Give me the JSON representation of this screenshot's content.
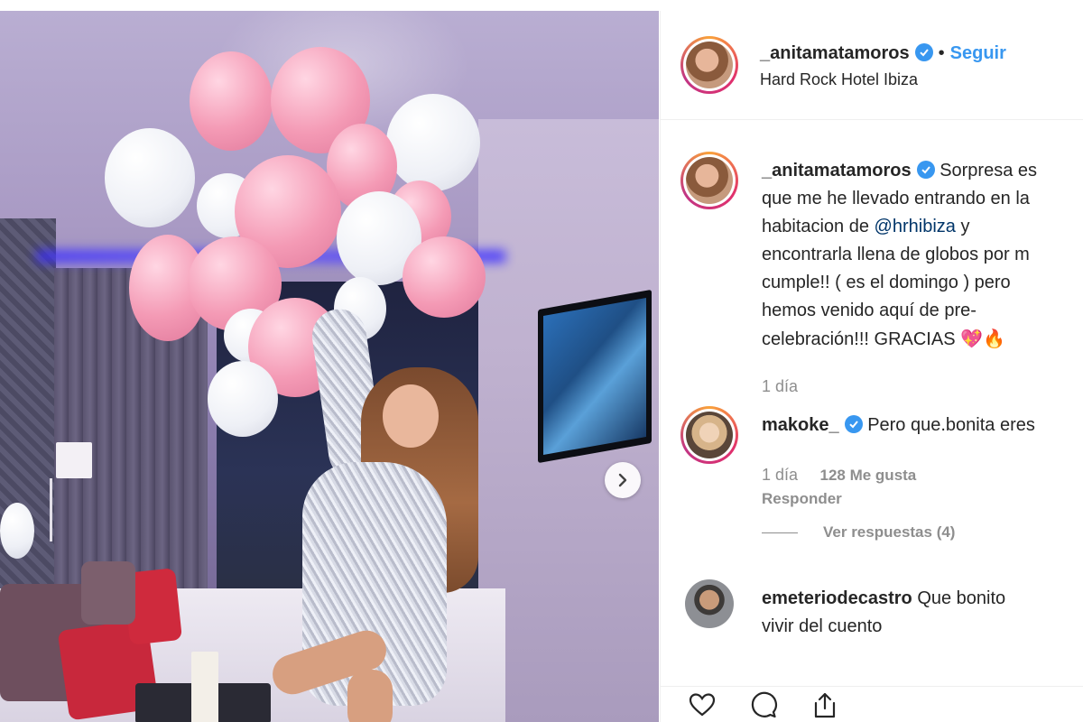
{
  "post": {
    "author": {
      "username": "_anitamatamoros",
      "verified": true,
      "follow_label": "Seguir",
      "separator": "•",
      "location": "Hard Rock Hotel Ibiza"
    },
    "caption": {
      "username": "_anitamatamoros",
      "lines": [
        "Sorpresa es",
        "que me he llevado entrando en la",
        "habitacion de",
        "encontrarla llena de globos por m",
        "cumple!! ( es el domingo ) pero",
        "hemos venido aquí de pre-",
        "celebración!!! GRACIAS"
      ],
      "mention": "@hrhibiza",
      "mention_suffix": " y",
      "emojis": [
        "💖",
        "🔥"
      ],
      "time": "1 día"
    },
    "comments": [
      {
        "username": "makoke_",
        "verified": true,
        "text": "Pero que.bonita eres",
        "time": "1 día",
        "likes": "128 Me gusta",
        "reply_label": "Responder",
        "view_replies": "Ver respuestas (4)"
      },
      {
        "username": "emeteriodecastro",
        "verified": false,
        "text_line1": "Que bonito",
        "text_line2": "vivir del cuento"
      }
    ],
    "actions": [
      "heart-icon",
      "comment-icon",
      "share-icon"
    ],
    "colors": {
      "link": "#3897f0",
      "mention": "#003569",
      "muted": "#8e8e8e",
      "text": "#262626"
    }
  }
}
